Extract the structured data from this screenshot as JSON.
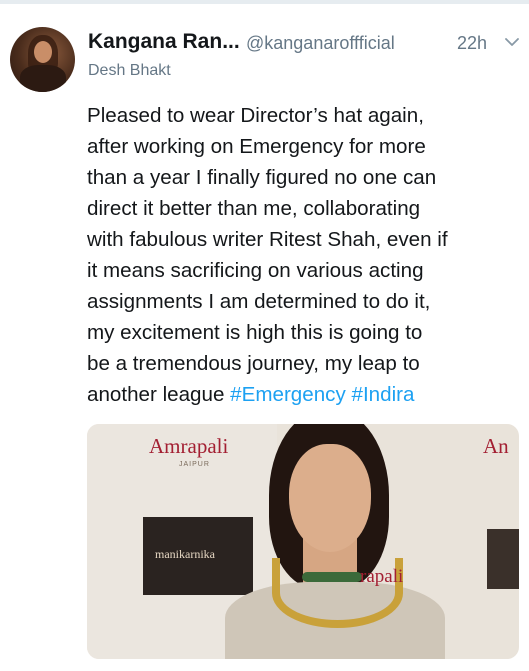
{
  "tweet": {
    "author_name": "Kangana Ran...",
    "handle": "@kanganaroffficial",
    "timestamp": "22h",
    "bio": "Desh Bhakt",
    "text_lines": [
      "Pleased to wear Director’s hat again,",
      "after working on Emergency for more",
      "than a year I finally figured no one can",
      "direct it better than me, collaborating",
      "with fabulous writer Ritest Shah, even if",
      "it means sacrificing on various acting",
      "assignments I am determined to do it,",
      "my excitement is high this is going to",
      "be a tremendous journey, my leap to",
      "another league "
    ],
    "hashtags": [
      "#Emergency",
      "#Indira"
    ]
  },
  "media": {
    "brand_left": "Amrapali",
    "brand_sub": "JAIPUR",
    "board_text": "manikarnika",
    "brand_right": "An",
    "brand_center": "rapali"
  },
  "icons": {
    "avatar": "profile-photo",
    "menu": "chevron-down-icon"
  },
  "colors": {
    "link": "#1da1f2",
    "secondary_text": "#657786",
    "primary_text": "#14171a"
  }
}
